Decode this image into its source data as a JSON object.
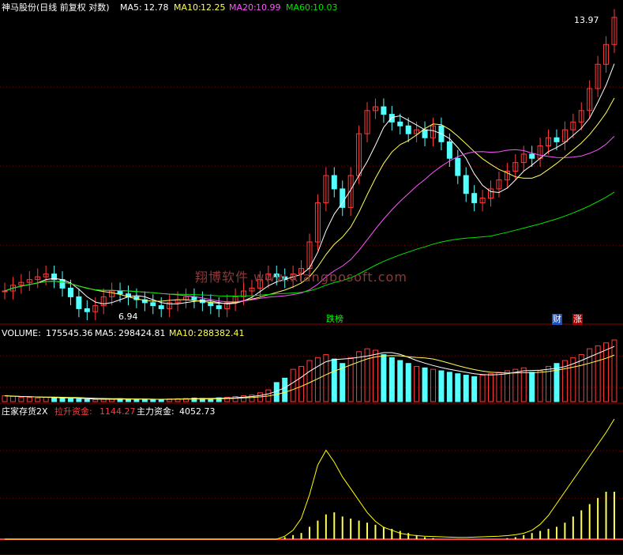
{
  "header": {
    "title": "神马股份(日线 前复权 对数)",
    "ma5_label": "MA5:",
    "ma5_value": "12.78",
    "ma10_label": "MA10:",
    "ma10_value": "12.25",
    "ma20_label": "MA20:",
    "ma20_value": "10.99",
    "ma60_label": "MA60:",
    "ma60_value": "10.03"
  },
  "annotations": {
    "high_price": "13.97",
    "low_price": "6.94",
    "tag_limit_down": "跌榜",
    "tag_finance": "财",
    "tag_rise": "涨",
    "watermark": "翔博软件 www.xiangbosoft.com"
  },
  "volume_panel": {
    "title": "VOLUME:",
    "value": "175545.36",
    "ma5_label": "MA5:",
    "ma5_value": "298424.81",
    "ma10_label": "MA10:",
    "ma10_value": "288382.41"
  },
  "indicator_panel": {
    "title": "庄家存货2X",
    "pull_label": "拉升资金:",
    "pull_value": "1144.27",
    "main_label": "主力资金:",
    "main_value": "4052.73"
  },
  "colors": {
    "background": "#000000",
    "up": "#ff3b3b",
    "down": "#54ffff",
    "ma5": "#ffffff",
    "ma10": "#ffff54",
    "ma20": "#ff54ff",
    "ma60": "#00e600",
    "grid": "#8b0000"
  },
  "chart_data": {
    "type": "candlestick",
    "log_scale": true,
    "ylim": [
      6.94,
      13.97
    ],
    "close": [
      7.3,
      7.4,
      7.45,
      7.5,
      7.55,
      7.6,
      7.5,
      7.35,
      7.2,
      7.0,
      6.95,
      7.05,
      7.2,
      7.3,
      7.25,
      7.2,
      7.15,
      7.1,
      7.05,
      7.0,
      7.1,
      7.15,
      7.2,
      7.15,
      7.1,
      7.05,
      7.0,
      7.1,
      7.2,
      7.3,
      7.35,
      7.5,
      7.6,
      7.55,
      7.5,
      7.6,
      7.7,
      8.2,
      9.0,
      9.6,
      9.3,
      8.9,
      9.6,
      10.6,
      11.2,
      11.3,
      11.1,
      10.9,
      10.8,
      10.6,
      10.7,
      10.5,
      10.8,
      10.4,
      10.0,
      9.6,
      9.2,
      9.0,
      9.1,
      9.3,
      9.5,
      9.7,
      9.9,
      10.1,
      10.0,
      10.3,
      10.5,
      10.4,
      10.7,
      10.9,
      11.2,
      11.8,
      12.5,
      13.1,
      13.97
    ],
    "volume": [
      40,
      35,
      30,
      28,
      25,
      30,
      26,
      22,
      20,
      18,
      15,
      14,
      16,
      18,
      20,
      18,
      16,
      15,
      14,
      16,
      18,
      20,
      22,
      24,
      22,
      20,
      26,
      30,
      35,
      40,
      45,
      60,
      80,
      130,
      160,
      220,
      240,
      280,
      300,
      320,
      290,
      260,
      300,
      340,
      360,
      350,
      320,
      300,
      280,
      260,
      240,
      230,
      220,
      210,
      200,
      190,
      180,
      170,
      180,
      190,
      200,
      210,
      220,
      230,
      200,
      210,
      240,
      260,
      280,
      300,
      320,
      360,
      380,
      400,
      420
    ],
    "pull_funds": [
      0,
      0,
      0,
      0,
      0,
      0,
      0,
      0,
      0,
      0,
      0,
      0,
      0,
      0,
      0,
      0,
      0,
      0,
      0,
      0,
      0,
      0,
      0,
      0,
      0,
      0,
      0,
      0,
      0,
      0,
      0,
      0,
      0,
      0,
      10,
      20,
      30,
      60,
      90,
      120,
      130,
      110,
      100,
      90,
      80,
      70,
      60,
      50,
      40,
      30,
      20,
      10,
      5,
      0,
      0,
      0,
      0,
      0,
      0,
      0,
      0,
      5,
      10,
      20,
      30,
      40,
      50,
      60,
      80,
      110,
      140,
      170,
      200,
      230,
      1144.27
    ],
    "main_funds": [
      0,
      0,
      0,
      0,
      0,
      0,
      0,
      0,
      0,
      0,
      0,
      0,
      0,
      0,
      0,
      0,
      0,
      0,
      0,
      0,
      0,
      0,
      0,
      0,
      0,
      0,
      0,
      0,
      0,
      0,
      0,
      0,
      0,
      0,
      100,
      300,
      700,
      1500,
      2500,
      3000,
      2600,
      2100,
      1700,
      1300,
      900,
      600,
      400,
      300,
      200,
      150,
      120,
      100,
      90,
      80,
      70,
      60,
      60,
      70,
      80,
      90,
      100,
      120,
      150,
      200,
      300,
      500,
      800,
      1200,
      1600,
      2000,
      2400,
      2800,
      3200,
      3600,
      4052.73
    ]
  }
}
